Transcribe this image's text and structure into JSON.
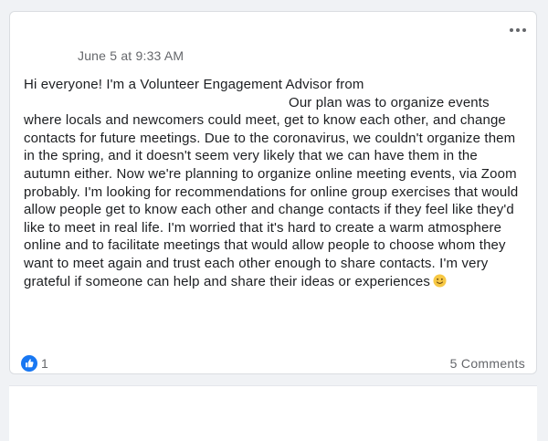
{
  "post": {
    "timestamp": "June 5 at 9:33 AM",
    "text_line_1": "Hi everyone! I'm a Volunteer Engagement Advisor from",
    "text_body": "Our plan was to organize events where locals and newcomers could meet, get to know each other, and change contacts for future meetings. Due to the coronavirus, we couldn't organize them in the spring, and it doesn't seem very likely that we can have them in the autumn either. Now we're planning to organize online meeting events, via Zoom probably. I'm looking for recommendations for online group exercises that would allow people get to know each other and change contacts if they feel like they'd like to meet in real life. I'm worried that it's hard to create a warm atmosphere online and to facilitate meetings that would allow people to choose whom they want to meet again and trust each other enough to share contacts. I'm very grateful if someone can help and share their ideas or experiences",
    "emoji": "slightly-smiling-face-icon",
    "more_icon": "more-options-icon"
  },
  "footer": {
    "like_icon": "like-thumbs-up-icon",
    "reaction_count": "1",
    "comments_label": "5 Comments"
  },
  "colors": {
    "like_blue": "#1877f2",
    "meta_gray": "#65676b",
    "emoji_yellow": "#f7c844"
  }
}
